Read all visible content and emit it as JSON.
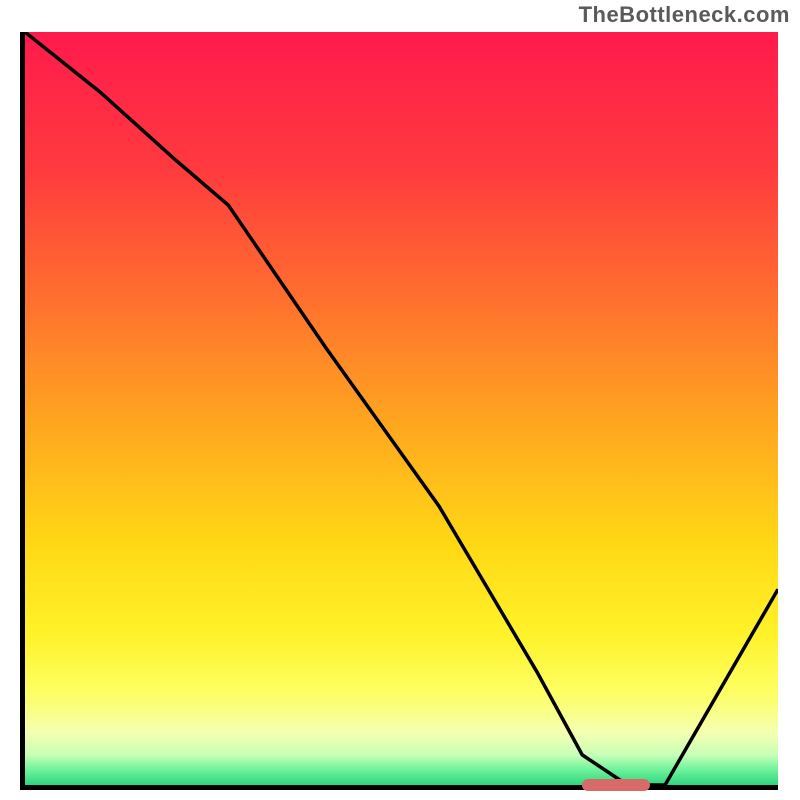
{
  "watermark": "TheBottleneck.com",
  "colors": {
    "curve": "#000000",
    "marker": "#d86a6a",
    "axis": "#000000"
  },
  "gradient_stops": [
    {
      "pct": 0,
      "color": "#ff1a4d"
    },
    {
      "pct": 18,
      "color": "#ff3a3e"
    },
    {
      "pct": 35,
      "color": "#ff6e2f"
    },
    {
      "pct": 52,
      "color": "#ffa61f"
    },
    {
      "pct": 68,
      "color": "#ffd815"
    },
    {
      "pct": 80,
      "color": "#fff22a"
    },
    {
      "pct": 88,
      "color": "#fdff66"
    },
    {
      "pct": 93,
      "color": "#f5ffb0"
    },
    {
      "pct": 96,
      "color": "#c8ffb8"
    },
    {
      "pct": 98,
      "color": "#6cf29a"
    },
    {
      "pct": 100,
      "color": "#2fd67f"
    }
  ],
  "chart_data": {
    "type": "line",
    "title": "",
    "xlabel": "",
    "ylabel": "",
    "xlim": [
      0,
      100
    ],
    "ylim": [
      0,
      100
    ],
    "series": [
      {
        "name": "bottleneck-curve",
        "x": [
          0,
          10,
          20,
          27,
          40,
          55,
          68,
          74,
          80,
          85,
          100
        ],
        "y": [
          100,
          92,
          83,
          77,
          58,
          37,
          15,
          4,
          0,
          0,
          26
        ]
      }
    ],
    "marker": {
      "name": "optimum-range",
      "x_start": 74,
      "x_end": 83,
      "y": 0
    }
  }
}
